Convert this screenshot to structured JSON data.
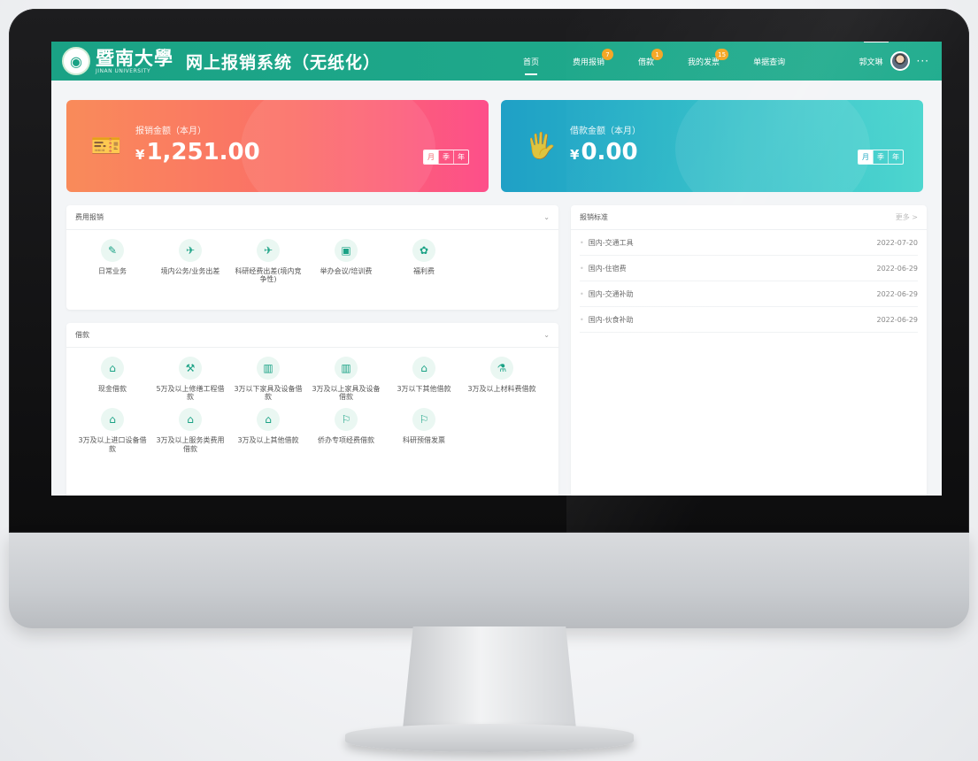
{
  "header": {
    "logo_cn": "暨南大學",
    "logo_en": "JINAN UNIVERSITY",
    "system_title": "网上报销系统（无纸化）",
    "nav": [
      {
        "label": "首页",
        "badge": ""
      },
      {
        "label": "费用报销",
        "badge": "7"
      },
      {
        "label": "借款",
        "badge": "1"
      },
      {
        "label": "我的发票",
        "badge": "15"
      },
      {
        "label": "单据查询",
        "badge": ""
      }
    ],
    "user_name": "郭文琳",
    "more": "···"
  },
  "stats": {
    "reimburse": {
      "label": "报销金额（本月）",
      "currency": "¥",
      "value": "1,251.00",
      "periods": [
        "月",
        "季",
        "年"
      ]
    },
    "loan": {
      "label": "借款金额（本月）",
      "currency": "¥",
      "value": "0.00",
      "periods": [
        "月",
        "季",
        "年"
      ]
    }
  },
  "fee_panel": {
    "title": "费用报销",
    "items": [
      {
        "label": "日常业务",
        "icon": "✎"
      },
      {
        "label": "境内公务/业务出差",
        "icon": "✈"
      },
      {
        "label": "科研经费出差(境内竞争性)",
        "icon": "✈"
      },
      {
        "label": "举办会议/培训费",
        "icon": "▣"
      },
      {
        "label": "福利费",
        "icon": "✿"
      }
    ]
  },
  "loan_panel": {
    "title": "借款",
    "items": [
      {
        "label": "现金借款",
        "icon": "⌂"
      },
      {
        "label": "5万及以上修缮工程借款",
        "icon": "⚒"
      },
      {
        "label": "3万以下家具及设备借款",
        "icon": "▥"
      },
      {
        "label": "3万及以上家具及设备借款",
        "icon": "▥"
      },
      {
        "label": "3万以下其他借款",
        "icon": "⌂"
      },
      {
        "label": "3万及以上材料费借款",
        "icon": "⚗"
      },
      {
        "label": "3万及以上进口设备借款",
        "icon": "⌂"
      },
      {
        "label": "3万及以上服务类费用借款",
        "icon": "⌂"
      },
      {
        "label": "3万及以上其他借款",
        "icon": "⌂"
      },
      {
        "label": "侨办专项经费借款",
        "icon": "⚐"
      },
      {
        "label": "科研预借发票",
        "icon": "⚐"
      }
    ]
  },
  "standards": {
    "title": "报销标准",
    "more": "更多 >",
    "rows": [
      {
        "name": "国内-交通工具",
        "date": "2022-07-20"
      },
      {
        "name": "国内-住宿费",
        "date": "2022-06-29"
      },
      {
        "name": "国内-交通补助",
        "date": "2022-06-29"
      },
      {
        "name": "国内-伙食补助",
        "date": "2022-06-29"
      }
    ]
  }
}
